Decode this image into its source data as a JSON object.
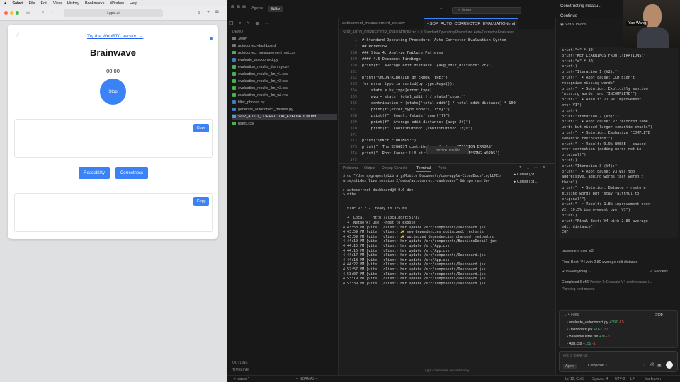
{
  "menubar": {
    "apple": "",
    "items": [
      "Safari",
      "File",
      "Edit",
      "View",
      "History",
      "Bookmarks",
      "Window",
      "Help"
    ]
  },
  "safari": {
    "url": "l.gpts.ai",
    "page": {
      "webrtc_link": "Try the WebRTC version →",
      "brand": "Brainwave",
      "timer": "00:00",
      "stop_label": "Stop",
      "copy_label": "Copy",
      "mode_buttons": [
        "Readability",
        "Correctness"
      ]
    }
  },
  "editor": {
    "top_tabs": [
      "Agents",
      "Editor"
    ],
    "search_placeholder": "demo",
    "explorer": {
      "section": "DEMO",
      "items": [
        ".venv",
        "autocorrect-dashboard",
        "autocorrect_measurement_set.csv",
        "evaluate_autocorrect.py",
        "evaluation_results_dummy.csv",
        "evaluation_results_llm_v1.csv",
        "evaluation_results_llm_v2.csv",
        "evaluation_results_llm_v3.csv",
        "evaluation_results_llm_v4.csv",
        "filter_phones.py",
        "generate_autocorrect_dataset.py",
        "SOP_AUTO_CORRECTOR_EVALUATION.md",
        "users.csv"
      ],
      "outline": "OUTLINE",
      "timeline": "TIMELINE"
    },
    "code_tabs": [
      "autocorrect_measurement_set.csv",
      "SOP_AUTO_CORRECTOR_EVALUATION.md"
    ],
    "breadcrumb": "SOP_AUTO_CORRECTOR_EVALUATION.md > # Standard Operating Procedure: Auto-Corrector Evaluation",
    "code_lines": [
      {
        "n": "1",
        "t": "# Standard Operating Procedure: Auto-Corrector Evaluation System"
      },
      {
        "n": "2",
        "t": "## Workflow"
      },
      {
        "n": "358",
        "t": "### Step 4: Analyze Failure Patterns"
      },
      {
        "n": "359",
        "t": "#### 4.5 Document Findings"
      },
      {
        "n": "360",
        "t": "print(f\"  Average edit distance: {avg_edit_distance:.2f}\")"
      },
      {
        "n": "361",
        "t": ""
      },
      {
        "n": "362",
        "t": "print(\"\\nCONTRIBUTION BY ERROR TYPE:\")"
      },
      {
        "n": "363",
        "t": "for error_type in sorted(by_type.keys()):"
      },
      {
        "n": "364",
        "t": "    stats = by_type[error_type]"
      },
      {
        "n": "365",
        "t": "    avg = stats['total_edit'] / stats['count']"
      },
      {
        "n": "366",
        "t": "    contribution = (stats['total_edit'] / total_edit_distance) * 100"
      },
      {
        "n": "367",
        "t": "    print(f\"{error_type.upper():15s}:\")"
      },
      {
        "n": "368",
        "t": "    print(f\"  Count: {stats['count']}\")"
      },
      {
        "n": "369",
        "t": "    print(f\"  Average edit distance: {avg:.2f}\")"
      },
      {
        "n": "370",
        "t": "    print(f\"  Contribution: {contribution:.1f}%\")"
      },
      {
        "n": "371",
        "t": ""
      },
      {
        "n": "372",
        "t": "print(\"\\nKEY FINDINGS:\")"
      },
      {
        "n": "373",
        "t": "print(\"  The BIGGEST contributing factor: OMISSION ERRORS\")"
      },
      {
        "n": "374",
        "t": "print(\"  Root Cause: LLM str...        ...ING MISSING WORDS\")"
      },
      {
        "n": "375",
        "t": "'''"
      }
    ],
    "review_chip": "Review next file",
    "panel_tabs": [
      "Problems",
      "Output",
      "Debug Console",
      "Terminal",
      "Ports"
    ],
    "terminal": [
      "$ cd \"/Users/grapest/Library/Mobile Documents/com~apple~CloudDocs/co/LLMCo",
      "urse/slides_live_session_2/demo/autocorrect-dashboard\" && npm run dev",
      "",
      "> autocorrect-dashboard@0.0.0 dev",
      "> vite",
      "",
      "",
      "  VITE v7.2.2  ready in 325 ms",
      "",
      "  ➜  Local:   http://localhost:5173/",
      "  ➜  Network: use --host to expose",
      "4:43:58 PM [vite] (client) hmr update /src/components/Dashboard.jsx",
      "4:43:59 PM [vite] (client) ✨ new dependencies optimized: recharts",
      "4:43:59 PM [vite] (client) ✨ optimized dependencies changed. reloading",
      "4:44:10 PM [vite] (client) hmr update /src/components/BaselineDetail.jsx",
      "4:44:15 PM [vite] (client) hmr update /src/App.css",
      "4:44:16 PM [vite] (client) hmr update /src/App.css",
      "4:44:17 PM [vite] (client) hmr update /src/components/Dashboard.jsx",
      "4:44:18 PM [vite] (client) hmr update /src/App.css",
      "4:44:22 PM [vite] (client) hmr update /src/components/Dashboard.jsx",
      "4:52:57 PM [vite] (client) hmr update /src/components/Dashboard.jsx",
      "4:53:07 PM [vite] (client) hmr update /src/components/Dashboard.jsx",
      "4:53:19 PM [vite] (client) hmr update /src/components/Dashboard.jsx",
      "4:53:39 PM [vite] (client) hmr update /src/components/Dashboard.jsx"
    ],
    "terminal_list": [
      "Cursor (cd ...",
      "Cursor (cd ..."
    ],
    "agent_footer": "Agent terminals are read-only",
    "status": {
      "branch": "master*",
      "mode": "-- NORMAL --",
      "position": "Ln 12, Col 3",
      "spaces": "Spaces: 4",
      "encoding": "UTF-8",
      "eol": "LF",
      "language": "Markdown"
    }
  },
  "agent": {
    "title": "Constructing measu...",
    "continue_label": "Continue",
    "todos": "6 of 6 To-dos",
    "code": [
      "print(\"=\" * 80)",
      "print(\"KEY LEARNINGS FROM ITERATIONS:\")",
      "print(\"=\" * 80)",
      "print()",
      "print(\"Iteration 1 (V2):\")",
      "print(\"  • Root cause: LLM didn't",
      "recognize missing words\")",
      "print(\"  • Solution: Explicitly mention",
      "'missing words' and 'INCOMPLETE'\")",
      "print(\"  • Result: 21.9% improvement",
      "over V1\")",
      "print()",
      "print(\"Iteration 2 (V3):\")",
      "print(\"  • Root cause: V2 restored some",
      "words but missed larger semantic chunks\")",
      "print(\"  • Solution: Emphasize 'COMPLETE",
      "semantic restoration'\")",
      "print(\"  • Result: 9.9% WORSE - caused",
      "over-correction (adding words not in",
      "original)\")",
      "print()",
      "print(\"Iteration 3 (V4):\")",
      "print(\"  • Root cause: V3 was too",
      "aggressive, adding words that weren't",
      "there\")",
      "print(\"  • Solution: Balance - restore",
      "missing words but 'stay faithful to",
      "original'\")",
      "print(\"  • Result: 1.8% improvement over",
      "V2, 10.5% improvement over V3\")",
      "print()",
      "print(\"Final Best: V4 with 2.80 average",
      "edit distance\")",
      "EOF"
    ],
    "after_1": "provement over V3",
    "after_2": "Final Best: V4 with 2.80 average edit distance",
    "run_label": "Run Everything",
    "success_label": "Success",
    "completed": "Completed 6 of 6",
    "completed_detail": "Version 2: Evaluate V4 and measure i...",
    "planning": "Planning next moves",
    "files_header": "4 Files",
    "stop_label": "Stop",
    "files": [
      {
        "name": "evaluate_autocorrect.py",
        "add": "+397",
        "del": "-15"
      },
      {
        "name": "Dashboard.jsx",
        "add": "+162",
        "del": "-32"
      },
      {
        "name": "BaselineDetail.jsx",
        "add": "+76",
        "del": "-21"
      },
      {
        "name": "App.css",
        "add": "+159",
        "del": "-1"
      }
    ],
    "input_placeholder": "Add a follow-up",
    "mode": "Agent",
    "model": "Composer 1"
  },
  "webcam": {
    "name": "Yan Wang"
  },
  "colors": {
    "accent": "#3b82f6",
    "success": "#4ec07d",
    "danger": "#e35d5d"
  }
}
